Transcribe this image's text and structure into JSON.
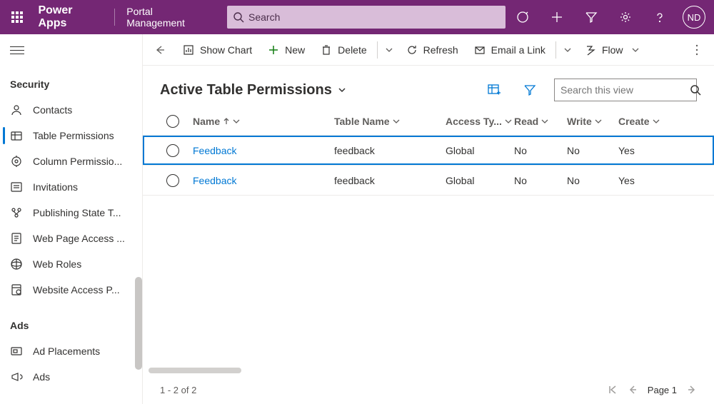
{
  "header": {
    "app_name": "Power Apps",
    "app_sub": "Portal Management",
    "search_placeholder": "Search",
    "avatar_initials": "ND"
  },
  "sidebar": {
    "groups": [
      {
        "heading": "Security",
        "items": [
          {
            "id": "contacts",
            "label": "Contacts",
            "selected": false
          },
          {
            "id": "table-permissions",
            "label": "Table Permissions",
            "selected": true
          },
          {
            "id": "column-permissions",
            "label": "Column Permissio...",
            "selected": false
          },
          {
            "id": "invitations",
            "label": "Invitations",
            "selected": false
          },
          {
            "id": "publishing-state",
            "label": "Publishing State T...",
            "selected": false
          },
          {
            "id": "web-page-access",
            "label": "Web Page Access ...",
            "selected": false
          },
          {
            "id": "web-roles",
            "label": "Web Roles",
            "selected": false
          },
          {
            "id": "website-access",
            "label": "Website Access P...",
            "selected": false
          }
        ]
      },
      {
        "heading": "Ads",
        "items": [
          {
            "id": "ad-placements",
            "label": "Ad Placements",
            "selected": false
          },
          {
            "id": "ads",
            "label": "Ads",
            "selected": false
          }
        ]
      }
    ]
  },
  "commandbar": {
    "show_chart": "Show Chart",
    "new": "New",
    "delete": "Delete",
    "refresh": "Refresh",
    "email_link": "Email a Link",
    "flow": "Flow"
  },
  "view": {
    "title": "Active Table Permissions",
    "search_placeholder": "Search this view"
  },
  "grid": {
    "columns": {
      "name": "Name",
      "table_name": "Table Name",
      "access_type": "Access Ty...",
      "read": "Read",
      "write": "Write",
      "create": "Create"
    },
    "rows": [
      {
        "selected": true,
        "name": "Feedback",
        "table_name": "feedback",
        "access_type": "Global",
        "read": "No",
        "write": "No",
        "create": "Yes"
      },
      {
        "selected": false,
        "name": "Feedback",
        "table_name": "feedback",
        "access_type": "Global",
        "read": "No",
        "write": "No",
        "create": "Yes"
      }
    ]
  },
  "footer": {
    "range": "1 - 2 of 2",
    "page_label": "Page 1"
  }
}
